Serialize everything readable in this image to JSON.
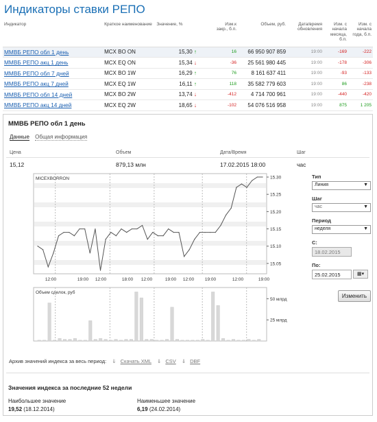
{
  "title": "Индикаторы ставки РЕПО",
  "table": {
    "headers": [
      "Индикатор",
      "Краткое наименование",
      "Значение, %",
      "Изм.к закр., б.п.",
      "Объем, руб.",
      "Дата/время обновления",
      "Изм. с начала месяца, б.п.",
      "Изм. с начала года, б.п."
    ],
    "rows": [
      {
        "name": "ММВБ РЕПО обл 1 день",
        "short": "MCX BO ON",
        "value": "15,30",
        "dir": "↑",
        "chg": "16",
        "vol": "66 950 907 859",
        "time": "19:00",
        "mon": "-169",
        "year": "-222"
      },
      {
        "name": "ММВБ РЕПО акц 1 день",
        "short": "MCX EQ ON",
        "value": "15,34",
        "dir": "↓",
        "chg": "-36",
        "vol": "25 561 980 445",
        "time": "19:00",
        "mon": "-178",
        "year": "-306"
      },
      {
        "name": "ММВБ РЕПО обл 7 дней",
        "short": "MCX BO 1W",
        "value": "16,29",
        "dir": "↑",
        "chg": "76",
        "vol": "8 161 637 411",
        "time": "19:00",
        "mon": "-93",
        "year": "-133"
      },
      {
        "name": "ММВБ РЕПО акц 7 дней",
        "short": "MCX EQ 1W",
        "value": "16,11",
        "dir": "↑",
        "chg": "118",
        "vol": "35 582 779 603",
        "time": "19:00",
        "mon": "86",
        "year": "-238"
      },
      {
        "name": "ММВБ РЕПО обл 14 дней",
        "short": "MCX BO 2W",
        "value": "13,74",
        "dir": "↓",
        "chg": "-412",
        "vol": "4 714 700 961",
        "time": "19:00",
        "mon": "-440",
        "year": "-420"
      },
      {
        "name": "ММВБ РЕПО акц 14 дней",
        "short": "MCX EQ 2W",
        "value": "18,65",
        "dir": "↓",
        "chg": "-102",
        "vol": "54 076 516 958",
        "time": "19:00",
        "mon": "875",
        "year": "1 205"
      }
    ]
  },
  "detail": {
    "title": "ММВБ РЕПО обл 1 день",
    "tab_data": "Данные",
    "tab_info": "Общая информация",
    "h_price": "Цена",
    "h_volume": "Объем",
    "h_datetime": "Дата/Время",
    "h_step": "Шаг",
    "price": "15,12",
    "volume": "879,13 млн",
    "datetime": "17.02.2015 18:00",
    "step": "час"
  },
  "controls": {
    "type_label": "Тип",
    "type_value": "Линия",
    "step_label": "Шаг",
    "step_value": "час",
    "period_label": "Период",
    "period_value": "неделя",
    "from_label": "С:",
    "from_value": "18.02.2015",
    "to_label": "По:",
    "to_value": "25.02.2015",
    "apply": "Изменить"
  },
  "archive": {
    "label": "Архив значений индекса за весь период:",
    "xml": "Скачать XML",
    "csv": "CSV",
    "dbf": "DBF"
  },
  "week52": {
    "title": "Значения индекса за последние 52 недели",
    "high_label": "Наибольшее значение",
    "high_value": "19,52",
    "high_date": "(18.12.2014)",
    "low_label": "Наименьшее значение",
    "low_value": "6,19",
    "low_date": "(24.02.2014)"
  },
  "chart_data": [
    {
      "type": "line",
      "title": "MICEXBORRON",
      "x": [
        "12:00",
        "19:00",
        "12:00",
        "18:00",
        "12:00",
        "19:00",
        "12:00",
        "19:00",
        "12:00",
        "19:00"
      ],
      "ylim": [
        15.02,
        15.31
      ],
      "yticks": [
        "15.30",
        "15.25",
        "15.20",
        "15.15",
        "15.10",
        "15.05"
      ],
      "values": [
        15.1,
        15.09,
        15.04,
        15.08,
        15.13,
        15.14,
        15.14,
        15.13,
        15.15,
        15.15,
        15.08,
        15.15,
        15.03,
        15.12,
        15.14,
        15.13,
        15.15,
        15.14,
        15.15,
        15.15,
        15.16,
        15.12,
        15.14,
        15.13,
        15.13,
        15.15,
        15.14,
        15.14,
        15.07,
        15.09,
        15.12,
        15.14,
        15.14,
        15.14,
        15.14,
        15.16,
        15.19,
        15.21,
        15.27,
        15.28,
        15.27,
        15.29,
        15.3,
        15.3
      ]
    },
    {
      "type": "bar",
      "title": "Объем сделок, руб",
      "yticks": [
        "50 млрд",
        "25 млрд"
      ],
      "ylim": [
        0,
        60
      ],
      "values": [
        1,
        1,
        45,
        1,
        3,
        2,
        2,
        3,
        1,
        1,
        24,
        2,
        3,
        2,
        1,
        2,
        1,
        2,
        2,
        58,
        51,
        2,
        2,
        1,
        1,
        2,
        40,
        2,
        1,
        1,
        1,
        1,
        2,
        1,
        58,
        42,
        3,
        1,
        2,
        1,
        1,
        2,
        1,
        2
      ]
    }
  ]
}
